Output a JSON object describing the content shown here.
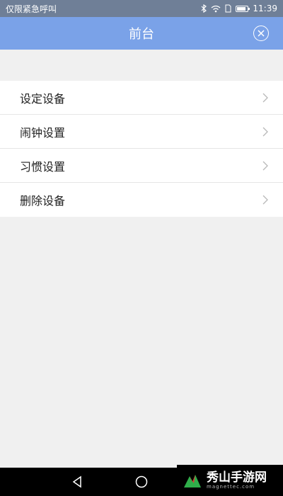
{
  "status_bar": {
    "carrier": "仅限紧急呼叫",
    "time": "11:39"
  },
  "header": {
    "title": "前台"
  },
  "menu": {
    "items": [
      {
        "label": "设定设备"
      },
      {
        "label": "闹钟设置"
      },
      {
        "label": "习惯设置"
      },
      {
        "label": "删除设备"
      }
    ]
  },
  "watermark": {
    "name": "秀山手游网",
    "domain": "magnettec.com"
  },
  "colors": {
    "status_bar": "#6f7f97",
    "title_bar": "#7aa2e8",
    "background": "#f0f0f0"
  },
  "icons": [
    "bluetooth-icon",
    "wifi-icon",
    "battery-icon",
    "close-circle-icon",
    "chevron-right-icon",
    "nav-back-icon",
    "nav-home-icon",
    "nav-recent-icon"
  ]
}
